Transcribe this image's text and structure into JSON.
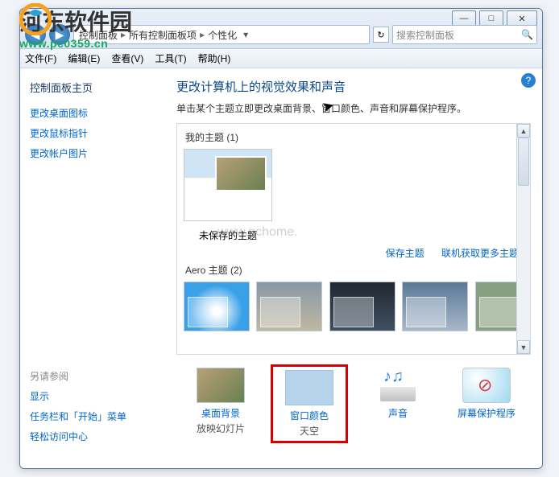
{
  "watermark": {
    "title": "河东软件园",
    "url": "www.pc0359.cn",
    "center": "www.pchome."
  },
  "window_controls": {
    "min": "—",
    "max": "□",
    "close": "✕"
  },
  "nav": {
    "back": "◀",
    "fwd": "▶"
  },
  "breadcrumb": {
    "seg1": "控制面板",
    "seg2": "所有控制面板项",
    "seg3": "个性化",
    "sep": "▸",
    "dropdown": "▾"
  },
  "refresh": "↻",
  "search": {
    "placeholder": "搜索控制面板",
    "icon": "🔍"
  },
  "menu": {
    "file": "文件(F)",
    "edit": "编辑(E)",
    "view": "查看(V)",
    "tools": "工具(T)",
    "help": "帮助(H)"
  },
  "sidebar": {
    "home": "控制面板主页",
    "links": [
      "更改桌面图标",
      "更改鼠标指针",
      "更改帐户图片"
    ],
    "see_also": "另请参阅",
    "links2": [
      "显示",
      "任务栏和「开始」菜单",
      "轻松访问中心"
    ]
  },
  "help": "?",
  "content": {
    "heading": "更改计算机上的视觉效果和声音",
    "subtext": "单击某个主题立即更改桌面背景、窗口颜色、声音和屏幕保护程序。",
    "my_themes": "我的主题 (1)",
    "unsaved": "未保存的主题",
    "save_theme": "保存主题",
    "more_themes": "联机获取更多主题",
    "aero_themes": "Aero 主题 (2)"
  },
  "scroll": {
    "up": "▲",
    "down": "▼"
  },
  "bottom": {
    "bg": {
      "label": "桌面背景",
      "sub": "放映幻灯片"
    },
    "color": {
      "label": "窗口颜色",
      "sub": "天空"
    },
    "sound": {
      "label": "声音",
      "sub": ""
    },
    "saver": {
      "label": "屏幕保护程序",
      "sub": ""
    }
  }
}
